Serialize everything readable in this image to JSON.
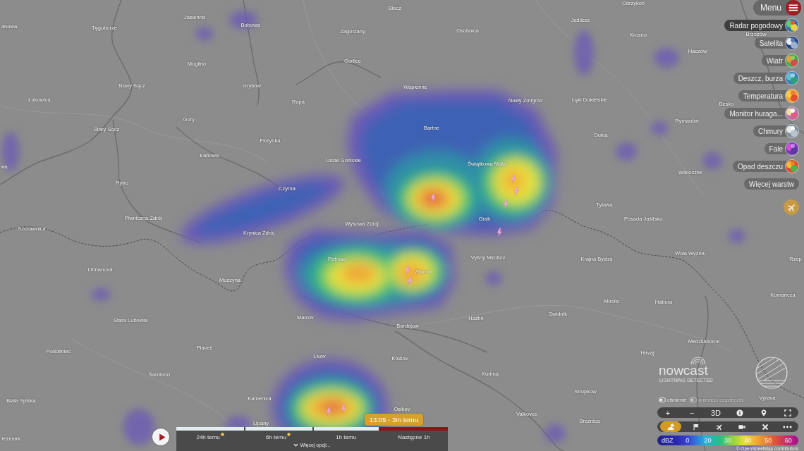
{
  "map": {
    "place_labels": [
      "anowa",
      "Tęgoborze",
      "Jasienna",
      "Bobowa",
      "Biecz",
      "Zagórzany",
      "Osobnica",
      "Jedlicze",
      "Odrzykoń",
      "Krosno",
      "Brzozów",
      "Haczów",
      "Mogilno",
      "Gorlice",
      "Nowy Sącz",
      "Grybów",
      "Wapienne",
      "Łukowica",
      "Ropa",
      "Nowy Żmigród",
      "Łęki Dukielskie",
      "Besko",
      "Gory",
      "Stary Sącz",
      "Bartne",
      "Rymanów",
      "Florynka",
      "Dukla",
      "Łabowa",
      "Uście Gorlickie",
      "Świątkowa Mała",
      "Wisłoczek",
      "wa",
      "Rytro",
      "Czyrna",
      "Tylawa",
      "Piwniczna Zdrój",
      "Grab",
      "Posada Jaśliska",
      "Szczawnica",
      "Krynica Zdrój",
      "Wysowa Zdrój",
      "Petrova",
      "Zborov",
      "Vyšný Mirošov",
      "Krajná Bystrá",
      "Wola Wyżna",
      "Rzep",
      "Litmanová",
      "Muszyna",
      "Komańcza",
      "Miroľa",
      "Habura",
      "Swidnik",
      "Malcov",
      "Hažlín",
      "Stara Lubowla",
      "Bardejow",
      "Medzilaborce",
      "Podoliniec",
      "Plaveč",
      "Havaj",
      "Livov",
      "Kľušov",
      "Šambron",
      "Kurima",
      "Stropkow",
      "Kamenica",
      "Biała Spiska",
      "Osikov",
      "Vyrava",
      "Valkovce",
      "Breznica",
      "Lipany",
      "ieżmark"
    ]
  },
  "menu": {
    "label": "Menu"
  },
  "layers": [
    {
      "label": "Radar pogodowy",
      "kind": "radar",
      "selected": true
    },
    {
      "label": "Satelita",
      "kind": "satellite",
      "selected": false
    },
    {
      "label": "Wiatr",
      "kind": "wind",
      "selected": false
    },
    {
      "label": "Deszcz, burza",
      "kind": "rain",
      "selected": false
    },
    {
      "label": "Temperatura",
      "kind": "temperature",
      "selected": false
    },
    {
      "label": "Monitor huraga...",
      "kind": "hurricane",
      "selected": false
    },
    {
      "label": "Chmury",
      "kind": "clouds",
      "selected": false
    },
    {
      "label": "Fale",
      "kind": "waves",
      "selected": false
    },
    {
      "label": "Opad deszczu",
      "kind": "precipitation",
      "selected": false
    },
    {
      "label": "Więcej warstw",
      "kind": "more",
      "selected": false
    }
  ],
  "timeline": {
    "tooltip": "13:05 - 3m temu",
    "level": 0.745,
    "steps": [
      {
        "label": "24h temu",
        "marker": true
      },
      {
        "label": "6h temu",
        "marker": true
      },
      {
        "label": "1h temu",
        "marker": false
      },
      {
        "label": "Następne 1h",
        "marker": false
      }
    ],
    "more_options": "Więcej opcji..."
  },
  "overlay_toggles": [
    {
      "label": "ciśnienie",
      "disabled": false
    },
    {
      "label": "animacja cząsteczek",
      "disabled": true
    }
  ],
  "toolbar": {
    "row_1": [
      {
        "kind": "text",
        "label": "+"
      },
      {
        "kind": "text",
        "label": "−"
      },
      {
        "kind": "text",
        "label": "3D"
      },
      {
        "kind": "info"
      },
      {
        "kind": "location"
      },
      {
        "kind": "fullscreen"
      }
    ],
    "row_2": [
      {
        "kind": "weather",
        "selected": true
      },
      {
        "kind": "flag",
        "selected": false
      },
      {
        "kind": "airplane",
        "selected": false
      },
      {
        "kind": "camera",
        "selected": false
      },
      {
        "kind": "cross",
        "selected": false
      },
      {
        "kind": "more",
        "selected": false
      }
    ]
  },
  "legend": {
    "unit": "dBZ",
    "ticks": [
      "0",
      "20",
      "30",
      "40",
      "50",
      "60"
    ]
  },
  "logo": {
    "name": "nowcast",
    "tagline": "LIGHTNING DETECTED"
  },
  "attribution": "© OpenStreetMap contributors"
}
